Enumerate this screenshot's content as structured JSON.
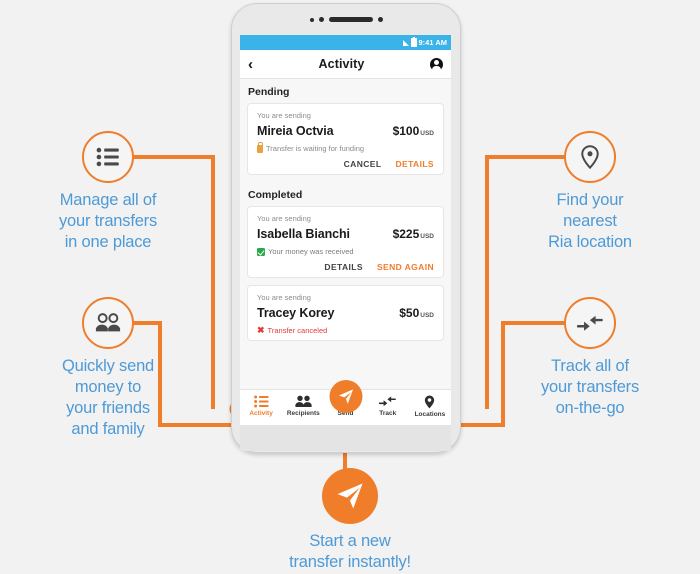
{
  "phone": {
    "status_bar": {
      "time": "9:41 AM",
      "signal_icon": "signal-bars-icon",
      "battery_icon": "battery-icon"
    },
    "header": {
      "back_icon": "back-chevron-icon",
      "title": "Activity",
      "profile_icon": "account-circle-icon"
    },
    "sections": [
      {
        "title": "Pending",
        "cards": [
          {
            "sending_label": "You are sending",
            "name": "Mireia Octvia",
            "amount": "$100",
            "currency": "USD",
            "status_icon": "lock-icon",
            "status_text": "Transfer is waiting for funding",
            "status_kind": "pending",
            "actions": [
              {
                "label": "CANCEL",
                "accent": false
              },
              {
                "label": "DETAILS",
                "accent": true
              }
            ]
          }
        ]
      },
      {
        "title": "Completed",
        "cards": [
          {
            "sending_label": "You are sending",
            "name": "Isabella Bianchi",
            "amount": "$225",
            "currency": "USD",
            "status_icon": "check-box-icon",
            "status_text": "Your money was received",
            "status_kind": "good",
            "actions": [
              {
                "label": "DETAILS",
                "accent": false
              },
              {
                "label": "SEND AGAIN",
                "accent": true
              }
            ]
          },
          {
            "sending_label": "You are sending",
            "name": "Tracey Korey",
            "amount": "$50",
            "currency": "USD",
            "status_icon": "x-mark-icon",
            "status_text": "Transfer canceled",
            "status_kind": "bad",
            "actions": []
          }
        ]
      }
    ],
    "bottom_nav": [
      {
        "label": "Activity",
        "icon": "list-icon",
        "active": true
      },
      {
        "label": "Recipients",
        "icon": "people-icon",
        "active": false
      },
      {
        "label": "Send",
        "icon": "paper-plane-icon",
        "active": false
      },
      {
        "label": "Track",
        "icon": "arrows-icon",
        "active": false
      },
      {
        "label": "Locations",
        "icon": "map-pin-icon",
        "active": false
      }
    ]
  },
  "annotations": {
    "manage": {
      "icon": "list-icon",
      "caption": "Manage all of\nyour transfers\nin one place"
    },
    "quickly": {
      "icon": "people-icon",
      "caption": "Quickly send\nmoney to\nyour friends\nand family"
    },
    "find": {
      "icon": "map-pin-icon",
      "caption": "Find your\nnearest\nRia location"
    },
    "track": {
      "icon": "arrows-icon",
      "caption": "Track all of\nyour transfers\non-the-go"
    },
    "start": {
      "icon": "paper-plane-icon",
      "caption": "Start a new\ntransfer instantly!"
    }
  },
  "colors": {
    "accent_orange": "#f07d2a",
    "caption_blue": "#4e9ad6",
    "status_blue": "#3ab4e8",
    "success_green": "#2aa84a",
    "error_red": "#e23b3b",
    "page_bg": "#f2f2f2"
  }
}
